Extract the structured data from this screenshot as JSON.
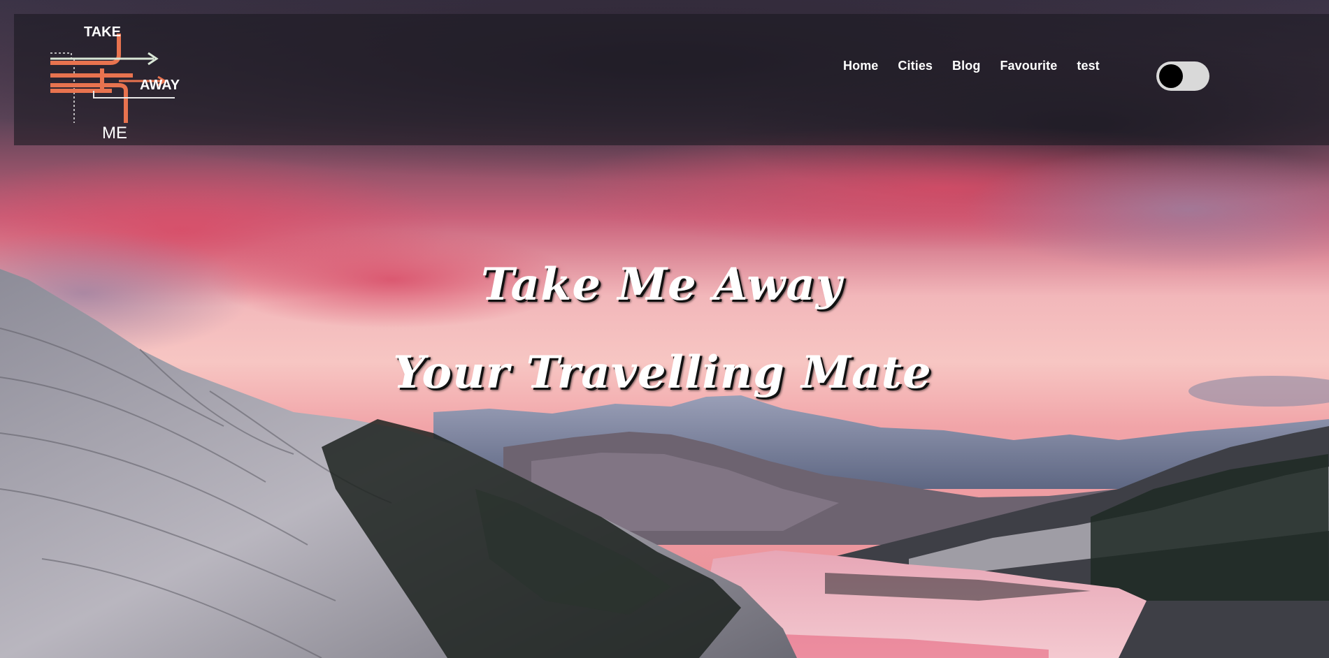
{
  "logo": {
    "text_top": "TAKE",
    "text_right": "AWAY",
    "text_bottom": "ME",
    "accent_color": "#e8734f",
    "arrow_color": "#d9e6d6"
  },
  "nav": {
    "items": [
      {
        "label": "Home"
      },
      {
        "label": "Cities"
      },
      {
        "label": "Blog"
      },
      {
        "label": "Favourite"
      },
      {
        "label": "test"
      }
    ]
  },
  "theme_toggle": {
    "state": "off",
    "track_color": "#d9d9d9",
    "knob_color": "#000000"
  },
  "hero": {
    "title": "Take Me Away",
    "subtitle": "Your Travelling Mate"
  }
}
